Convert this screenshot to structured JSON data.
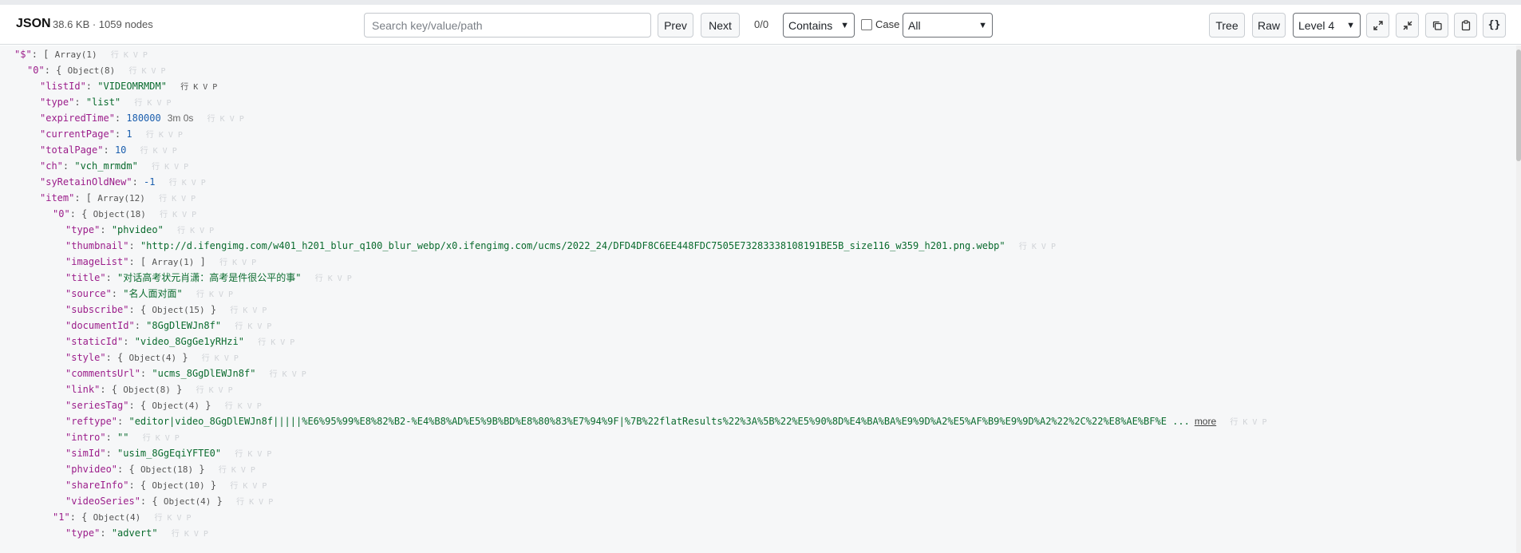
{
  "toolbar": {
    "title": "JSON",
    "stats": "38.6 KB · 1059 nodes",
    "search_placeholder": "Search key/value/path",
    "prev_label": "Prev",
    "next_label": "Next",
    "match_count": "0/0",
    "match_mode": "Contains",
    "case_label": "Case",
    "scope": "All",
    "tree_label": "Tree",
    "raw_label": "Raw",
    "level": "Level 4",
    "icons": [
      "expand-all-icon",
      "collapse-all-icon",
      "copy-icon",
      "paste-icon",
      "format-braces-icon"
    ]
  },
  "actions": {
    "row": "行",
    "key": "K",
    "value": "V",
    "path": "P"
  },
  "tree": {
    "root_key": "\"$\"",
    "root_type": "Array(1)",
    "item0_key": "\"0\"",
    "item0_type": "Object(8)",
    "listId_key": "\"listId\"",
    "listId_val": "\"VIDEOMRMDM\"",
    "type_key": "\"type\"",
    "type_val": "\"list\"",
    "expiredTime_key": "\"expiredTime\"",
    "expiredTime_val": "180000",
    "expiredTime_human": "3m 0s",
    "currentPage_key": "\"currentPage\"",
    "currentPage_val": "1",
    "totalPage_key": "\"totalPage\"",
    "totalPage_val": "10",
    "ch_key": "\"ch\"",
    "ch_val": "\"vch_mrmdm\"",
    "syRetain_key": "\"syRetainOldNew\"",
    "syRetain_val": "-1",
    "item_key": "\"item\"",
    "item_type": "Array(12)",
    "i0_key": "\"0\"",
    "i0_type": "Object(18)",
    "i0_type_key": "\"type\"",
    "i0_type_val": "\"phvideo\"",
    "thumb_key": "\"thumbnail\"",
    "thumb_val": "\"http://d.ifengimg.com/w401_h201_blur_q100_blur_webp/x0.ifengimg.com/ucms/2022_24/DFD4DF8C6EE448FDC7505E73283338108191BE5B_size116_w359_h201.png.webp\"",
    "imageList_key": "\"imageList\"",
    "imageList_type": "Array(1)",
    "title_key": "\"title\"",
    "title_val": "\"对话高考状元肖潇：高考是件很公平的事\"",
    "source_key": "\"source\"",
    "source_val": "\"名人面对面\"",
    "subscribe_key": "\"subscribe\"",
    "subscribe_type": "Object(15)",
    "documentId_key": "\"documentId\"",
    "documentId_val": "\"8GgDlEWJn8f\"",
    "staticId_key": "\"staticId\"",
    "staticId_val": "\"video_8GgGe1yRHzi\"",
    "style_key": "\"style\"",
    "style_type": "Object(4)",
    "commentsUrl_key": "\"commentsUrl\"",
    "commentsUrl_val": "\"ucms_8GgDlEWJn8f\"",
    "link_key": "\"link\"",
    "link_type": "Object(8)",
    "seriesTag_key": "\"seriesTag\"",
    "seriesTag_type": "Object(4)",
    "reftype_key": "\"reftype\"",
    "reftype_val": "\"editor|video_8GgDlEWJn8f|||||%E6%95%99%E8%82%B2-%E4%B8%AD%E5%9B%BD%E8%80%83%E7%94%9F|%7B%22flatResults%22%3A%5B%22%E5%90%8D%E4%BA%BA%E9%9D%A2%E5%AF%B9%E9%9D%A2%22%2C%22%E8%AE%BF%E ...",
    "reftype_more": "more",
    "intro_key": "\"intro\"",
    "intro_val": "\"\"",
    "simId_key": "\"simId\"",
    "simId_val": "\"usim_8GgEqiYFTE0\"",
    "phvideo_key": "\"phvideo\"",
    "phvideo_type": "Object(18)",
    "shareInfo_key": "\"shareInfo\"",
    "shareInfo_type": "Object(10)",
    "videoSeries_key": "\"videoSeries\"",
    "videoSeries_type": "Object(4)",
    "i1_key": "\"1\"",
    "i1_type": "Object(4)",
    "i1_type_key": "\"type\"",
    "i1_type_val": "\"advert\""
  }
}
